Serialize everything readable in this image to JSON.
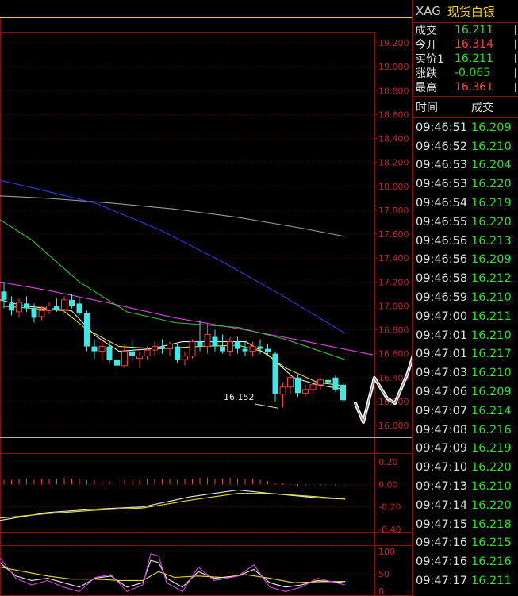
{
  "symbol": {
    "code": "XAG",
    "name": "现货白银"
  },
  "quote": [
    {
      "label": "成交",
      "value": "16.211",
      "color": "green"
    },
    {
      "label": "今开",
      "value": "16.314",
      "color": "red"
    },
    {
      "label": "买价1",
      "value": "16.211",
      "color": "green"
    },
    {
      "label": "涨跌",
      "value": "-0.065",
      "color": "green"
    },
    {
      "label": "最高",
      "value": "16.361",
      "color": "red"
    }
  ],
  "ticks_header": {
    "time": "时间",
    "price": "成交"
  },
  "ticks": [
    {
      "time": "09:46:51",
      "price": "16.209"
    },
    {
      "time": "09:46:52",
      "price": "16.210"
    },
    {
      "time": "09:46:53",
      "price": "16.204"
    },
    {
      "time": "09:46:53",
      "price": "16.220"
    },
    {
      "time": "09:46:54",
      "price": "16.219"
    },
    {
      "time": "09:46:55",
      "price": "16.220"
    },
    {
      "time": "09:46:56",
      "price": "16.213"
    },
    {
      "time": "09:46:56",
      "price": "16.209"
    },
    {
      "time": "09:46:58",
      "price": "16.212"
    },
    {
      "time": "09:46:59",
      "price": "16.210"
    },
    {
      "time": "09:47:00",
      "price": "16.211"
    },
    {
      "time": "09:47:01",
      "price": "16.210"
    },
    {
      "time": "09:47:01",
      "price": "16.217"
    },
    {
      "time": "09:47:03",
      "price": "16.210"
    },
    {
      "time": "09:47:06",
      "price": "16.209"
    },
    {
      "time": "09:47:07",
      "price": "16.214"
    },
    {
      "time": "09:47:08",
      "price": "16.216"
    },
    {
      "time": "09:47:09",
      "price": "16.219"
    },
    {
      "time": "09:47:10",
      "price": "16.220"
    },
    {
      "time": "09:47:13",
      "price": "16.210"
    },
    {
      "time": "09:47:14",
      "price": "16.220"
    },
    {
      "time": "09:47:15",
      "price": "16.218"
    },
    {
      "time": "09:47:16",
      "price": "16.215"
    },
    {
      "time": "09:47:16",
      "price": "16.216"
    },
    {
      "time": "09:47:17",
      "price": "16.211"
    }
  ],
  "chart_data": {
    "type": "candlestick",
    "price_axis": {
      "ylim": [
        15.95,
        19.25
      ],
      "ticks": [
        "19.200",
        "19.000",
        "18.800",
        "18.600",
        "18.400",
        "18.200",
        "18.000",
        "17.800",
        "17.600",
        "17.400",
        "17.200",
        "17.000",
        "16.800",
        "16.600",
        "16.400",
        "16.200",
        "16.000"
      ]
    },
    "annotation": {
      "text": "16.152",
      "value": 16.152
    },
    "candles": [
      {
        "o": 17.12,
        "h": 17.2,
        "l": 16.98,
        "c": 17.05
      },
      {
        "o": 17.02,
        "h": 17.08,
        "l": 16.92,
        "c": 16.96
      },
      {
        "o": 16.95,
        "h": 17.06,
        "l": 16.9,
        "c": 17.03
      },
      {
        "o": 17.02,
        "h": 17.08,
        "l": 16.95,
        "c": 16.98
      },
      {
        "o": 16.98,
        "h": 17.02,
        "l": 16.86,
        "c": 16.9
      },
      {
        "o": 16.91,
        "h": 17.0,
        "l": 16.88,
        "c": 16.96
      },
      {
        "o": 16.96,
        "h": 17.03,
        "l": 16.93,
        "c": 17.0
      },
      {
        "o": 17.0,
        "h": 17.06,
        "l": 16.95,
        "c": 16.97
      },
      {
        "o": 16.97,
        "h": 17.08,
        "l": 16.94,
        "c": 17.05
      },
      {
        "o": 17.05,
        "h": 17.1,
        "l": 16.98,
        "c": 17.0
      },
      {
        "o": 17.02,
        "h": 17.06,
        "l": 16.92,
        "c": 16.94
      },
      {
        "o": 16.94,
        "h": 16.96,
        "l": 16.62,
        "c": 16.66
      },
      {
        "o": 16.66,
        "h": 16.72,
        "l": 16.56,
        "c": 16.62
      },
      {
        "o": 16.62,
        "h": 16.7,
        "l": 16.55,
        "c": 16.66
      },
      {
        "o": 16.66,
        "h": 16.7,
        "l": 16.52,
        "c": 16.55
      },
      {
        "o": 16.55,
        "h": 16.62,
        "l": 16.45,
        "c": 16.5
      },
      {
        "o": 16.5,
        "h": 16.68,
        "l": 16.48,
        "c": 16.62
      },
      {
        "o": 16.62,
        "h": 16.72,
        "l": 16.55,
        "c": 16.58
      },
      {
        "o": 16.56,
        "h": 16.62,
        "l": 16.48,
        "c": 16.58
      },
      {
        "o": 16.58,
        "h": 16.66,
        "l": 16.55,
        "c": 16.63
      },
      {
        "o": 16.63,
        "h": 16.7,
        "l": 16.58,
        "c": 16.66
      },
      {
        "o": 16.66,
        "h": 16.72,
        "l": 16.6,
        "c": 16.64
      },
      {
        "o": 16.64,
        "h": 16.7,
        "l": 16.58,
        "c": 16.68
      },
      {
        "o": 16.66,
        "h": 16.68,
        "l": 16.52,
        "c": 16.55
      },
      {
        "o": 16.55,
        "h": 16.62,
        "l": 16.5,
        "c": 16.58
      },
      {
        "o": 16.58,
        "h": 16.72,
        "l": 16.56,
        "c": 16.7
      },
      {
        "o": 16.7,
        "h": 16.88,
        "l": 16.62,
        "c": 16.66
      },
      {
        "o": 16.66,
        "h": 16.86,
        "l": 16.6,
        "c": 16.76
      },
      {
        "o": 16.74,
        "h": 16.8,
        "l": 16.62,
        "c": 16.66
      },
      {
        "o": 16.66,
        "h": 16.76,
        "l": 16.6,
        "c": 16.62
      },
      {
        "o": 16.62,
        "h": 16.74,
        "l": 16.58,
        "c": 16.7
      },
      {
        "o": 16.7,
        "h": 16.74,
        "l": 16.6,
        "c": 16.64
      },
      {
        "o": 16.64,
        "h": 16.7,
        "l": 16.58,
        "c": 16.62
      },
      {
        "o": 16.62,
        "h": 16.7,
        "l": 16.58,
        "c": 16.66
      },
      {
        "o": 16.66,
        "h": 16.72,
        "l": 16.6,
        "c": 16.64
      },
      {
        "o": 16.64,
        "h": 16.68,
        "l": 16.58,
        "c": 16.61
      },
      {
        "o": 16.6,
        "h": 16.62,
        "l": 16.2,
        "c": 16.26
      },
      {
        "o": 16.26,
        "h": 16.36,
        "l": 16.15,
        "c": 16.32
      },
      {
        "o": 16.32,
        "h": 16.42,
        "l": 16.26,
        "c": 16.4
      },
      {
        "o": 16.4,
        "h": 16.42,
        "l": 16.24,
        "c": 16.27
      },
      {
        "o": 16.27,
        "h": 16.34,
        "l": 16.24,
        "c": 16.3
      },
      {
        "o": 16.3,
        "h": 16.36,
        "l": 16.26,
        "c": 16.34
      },
      {
        "o": 16.34,
        "h": 16.4,
        "l": 16.3,
        "c": 16.38
      },
      {
        "o": 16.38,
        "h": 16.4,
        "l": 16.32,
        "c": 16.36
      },
      {
        "o": 16.4,
        "h": 16.42,
        "l": 16.28,
        "c": 16.3
      },
      {
        "o": 16.34,
        "h": 16.36,
        "l": 16.19,
        "c": 16.21
      }
    ],
    "ma_blue": [
      [
        0,
        18.05
      ],
      [
        40,
        17.99
      ],
      [
        120,
        17.86
      ],
      [
        200,
        17.64
      ],
      [
        280,
        17.37
      ],
      [
        360,
        17.07
      ],
      [
        435,
        16.77
      ]
    ],
    "ma_gray": [
      [
        0,
        17.92
      ],
      [
        60,
        17.9
      ],
      [
        140,
        17.86
      ],
      [
        220,
        17.81
      ],
      [
        300,
        17.74
      ],
      [
        380,
        17.65
      ],
      [
        435,
        17.58
      ]
    ],
    "ma_magenta": [
      [
        0,
        17.2
      ],
      [
        60,
        17.13
      ],
      [
        140,
        17.02
      ],
      [
        220,
        16.9
      ],
      [
        300,
        16.81
      ],
      [
        380,
        16.71
      ],
      [
        470,
        16.59
      ]
    ],
    "ma_green": [
      [
        0,
        17.72
      ],
      [
        40,
        17.55
      ],
      [
        100,
        17.2
      ],
      [
        160,
        16.95
      ],
      [
        220,
        16.86
      ],
      [
        300,
        16.82
      ],
      [
        360,
        16.72
      ],
      [
        435,
        16.55
      ]
    ],
    "ma_white": [
      [
        0,
        17.05
      ],
      [
        30,
        17.0
      ],
      [
        60,
        16.98
      ],
      [
        90,
        16.96
      ],
      [
        120,
        16.75
      ],
      [
        150,
        16.62
      ],
      [
        190,
        16.64
      ],
      [
        230,
        16.7
      ],
      [
        270,
        16.7
      ],
      [
        310,
        16.7
      ],
      [
        340,
        16.58
      ],
      [
        370,
        16.4
      ],
      [
        400,
        16.34
      ],
      [
        435,
        16.3
      ]
    ],
    "ma_yellow": [
      [
        0,
        17.0
      ],
      [
        40,
        16.98
      ],
      [
        80,
        16.96
      ],
      [
        110,
        16.8
      ],
      [
        150,
        16.66
      ],
      [
        200,
        16.64
      ],
      [
        250,
        16.66
      ],
      [
        300,
        16.67
      ],
      [
        330,
        16.62
      ],
      [
        360,
        16.48
      ],
      [
        400,
        16.36
      ],
      [
        435,
        16.33
      ]
    ],
    "macd_axis": {
      "ticks": [
        "0.20",
        "0.00",
        "-0.20",
        "-0.40"
      ],
      "ylim": [
        -0.4,
        0.24
      ]
    },
    "macd_hist": [
      0.04,
      0.04,
      0.05,
      0.05,
      0.04,
      0.05,
      0.05,
      0.05,
      0.06,
      0.05,
      0.05,
      0.04,
      0.04,
      0.03,
      0.03,
      0.03,
      0.04,
      0.04,
      0.04,
      0.05,
      0.05,
      0.05,
      0.05,
      0.04,
      0.05,
      0.05,
      0.06,
      0.06,
      0.05,
      0.05,
      0.06,
      0.05,
      0.05,
      0.05,
      0.04,
      0.03,
      0.01,
      0.01,
      0.005,
      -0.01,
      -0.01,
      -0.01,
      -0.01,
      -0.005,
      -0.01,
      -0.01
    ],
    "macd_white": [
      [
        0,
        -0.32
      ],
      [
        60,
        -0.25
      ],
      [
        120,
        -0.22
      ],
      [
        180,
        -0.2
      ],
      [
        240,
        -0.11
      ],
      [
        300,
        -0.05
      ],
      [
        340,
        -0.08
      ],
      [
        400,
        -0.12
      ],
      [
        435,
        -0.13
      ]
    ],
    "macd_yellow": [
      [
        0,
        -0.3
      ],
      [
        60,
        -0.26
      ],
      [
        120,
        -0.23
      ],
      [
        180,
        -0.21
      ],
      [
        240,
        -0.14
      ],
      [
        300,
        -0.08
      ],
      [
        340,
        -0.08
      ],
      [
        400,
        -0.11
      ],
      [
        435,
        -0.13
      ]
    ],
    "kdj_axis": {
      "ticks": [
        "100",
        "50",
        "0"
      ],
      "ylim": [
        0,
        100
      ]
    },
    "kdj_k": [
      [
        0,
        75
      ],
      [
        20,
        45
      ],
      [
        40,
        35
      ],
      [
        60,
        40
      ],
      [
        80,
        30
      ],
      [
        100,
        20
      ],
      [
        120,
        40
      ],
      [
        140,
        45
      ],
      [
        160,
        20
      ],
      [
        180,
        30
      ],
      [
        190,
        80
      ],
      [
        200,
        75
      ],
      [
        210,
        40
      ],
      [
        230,
        20
      ],
      [
        250,
        55
      ],
      [
        270,
        40
      ],
      [
        300,
        45
      ],
      [
        320,
        60
      ],
      [
        340,
        30
      ],
      [
        360,
        20
      ],
      [
        380,
        25
      ],
      [
        400,
        35
      ],
      [
        435,
        30
      ]
    ],
    "kdj_d": [
      [
        0,
        65
      ],
      [
        30,
        55
      ],
      [
        60,
        45
      ],
      [
        90,
        38
      ],
      [
        120,
        38
      ],
      [
        150,
        35
      ],
      [
        180,
        35
      ],
      [
        200,
        55
      ],
      [
        220,
        42
      ],
      [
        250,
        45
      ],
      [
        280,
        42
      ],
      [
        310,
        48
      ],
      [
        340,
        40
      ],
      [
        370,
        30
      ],
      [
        400,
        32
      ],
      [
        435,
        33
      ]
    ],
    "kdj_j": [
      [
        0,
        85
      ],
      [
        20,
        40
      ],
      [
        40,
        25
      ],
      [
        60,
        35
      ],
      [
        80,
        20
      ],
      [
        100,
        10
      ],
      [
        120,
        42
      ],
      [
        140,
        48
      ],
      [
        160,
        10
      ],
      [
        180,
        25
      ],
      [
        190,
        95
      ],
      [
        200,
        90
      ],
      [
        210,
        30
      ],
      [
        230,
        10
      ],
      [
        250,
        65
      ],
      [
        270,
        35
      ],
      [
        300,
        45
      ],
      [
        320,
        70
      ],
      [
        340,
        20
      ],
      [
        360,
        10
      ],
      [
        380,
        20
      ],
      [
        400,
        40
      ],
      [
        435,
        25
      ]
    ]
  }
}
